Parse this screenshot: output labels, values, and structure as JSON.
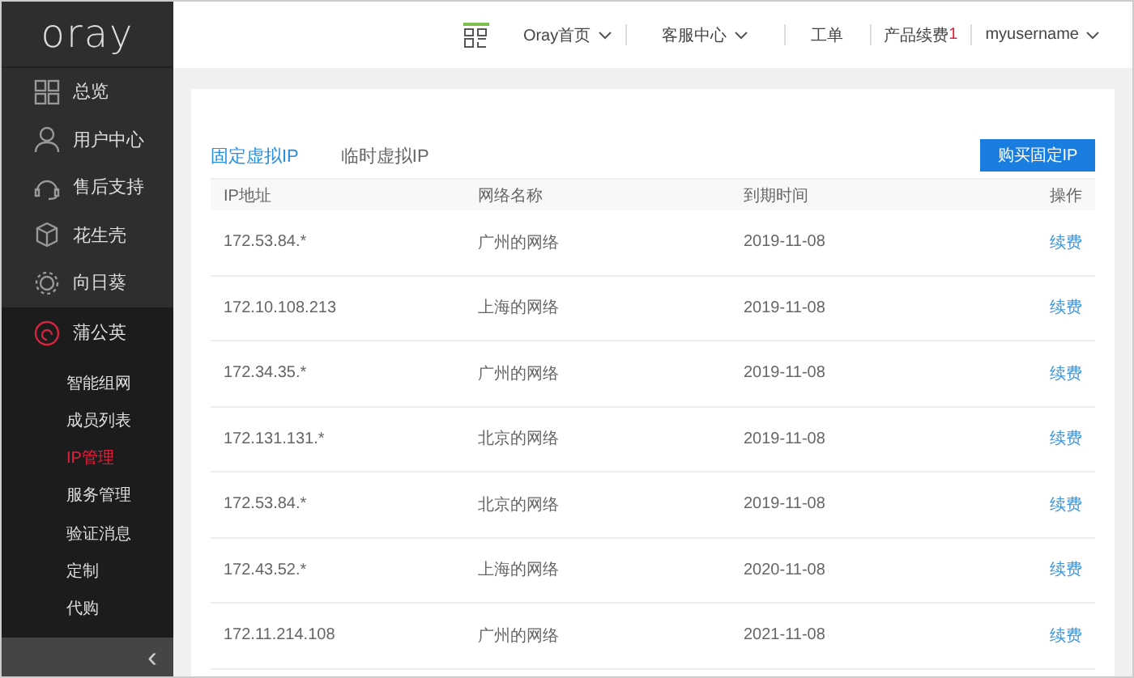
{
  "sidebar": {
    "logo": "oray",
    "items": [
      {
        "label": "总览"
      },
      {
        "label": "用户中心"
      },
      {
        "label": "售后支持"
      },
      {
        "label": "花生壳"
      },
      {
        "label": "向日葵"
      },
      {
        "label": "蒲公英",
        "expanded": true,
        "children": [
          {
            "label": "智能组网",
            "selected": false
          },
          {
            "label": "成员列表",
            "selected": false
          },
          {
            "label": "IP管理",
            "selected": true
          },
          {
            "label": "服务管理",
            "selected": false
          },
          {
            "label": "验证消息",
            "selected": false
          },
          {
            "label": "定制",
            "selected": false
          },
          {
            "label": "代购",
            "selected": false
          }
        ]
      }
    ],
    "collapse": "‹"
  },
  "header": {
    "nav": [
      {
        "label": "Oray首页",
        "has_menu": true
      },
      {
        "label": "客服中心",
        "has_menu": true
      },
      {
        "label": "工单",
        "has_menu": false
      },
      {
        "label": "产品续费",
        "has_menu": false,
        "badge": "1"
      },
      {
        "label": "myusername",
        "has_menu": true
      }
    ]
  },
  "tabs": [
    {
      "label": "固定虚拟IP",
      "selected": true
    },
    {
      "label": "临时虚拟IP",
      "selected": false
    }
  ],
  "buy_button": "购买固定IP",
  "table": {
    "columns": [
      "IP地址",
      "网络名称",
      "到期时间",
      "操作"
    ],
    "rows": [
      [
        "172.53.84.*",
        "广州的网络",
        "2019-11-08",
        "续费"
      ],
      [
        "172.10.108.213",
        "上海的网络",
        "2019-11-08",
        "续费"
      ],
      [
        "172.34.35.*",
        "广州的网络",
        "2019-11-08",
        "续费"
      ],
      [
        "172.131.131.*",
        "北京的网络",
        "2019-11-08",
        "续费"
      ],
      [
        "172.53.84.*",
        "北京的网络",
        "2019-11-08",
        "续费"
      ],
      [
        "172.43.52.*",
        "上海的网络",
        "2020-11-08",
        "续费"
      ],
      [
        "172.11.214.108",
        "广州的网络",
        "2021-11-08",
        "续费"
      ]
    ]
  }
}
